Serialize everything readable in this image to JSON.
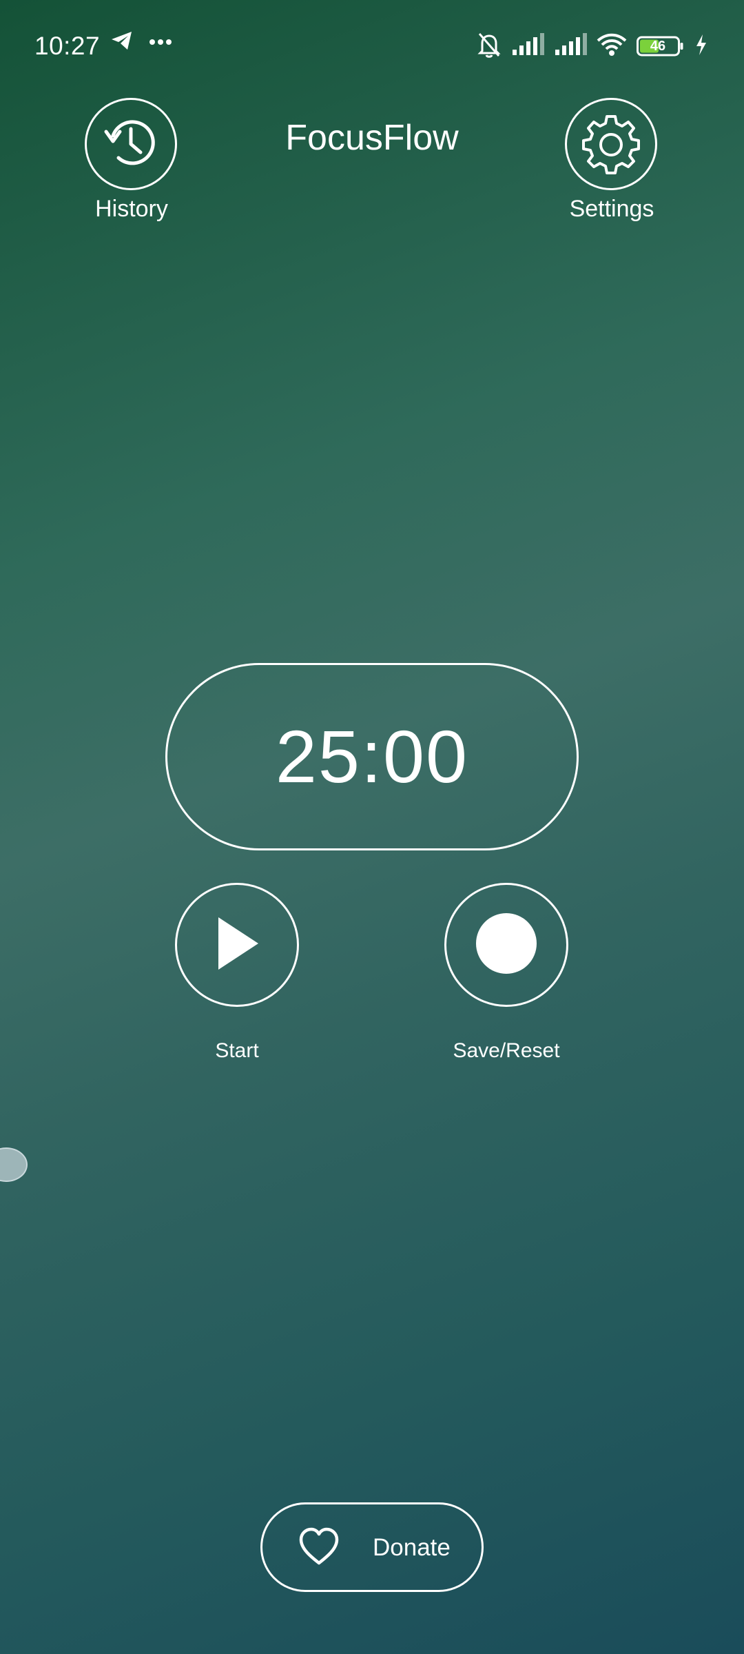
{
  "status_bar": {
    "time": "10:27",
    "battery_level": "46",
    "icons": [
      "telegram-icon",
      "more-dots-icon",
      "mute-bell-icon",
      "signal-icon",
      "signal-icon",
      "wifi-icon",
      "battery-icon",
      "charging-icon"
    ]
  },
  "header": {
    "title": "FocusFlow",
    "history_label": "History",
    "settings_label": "Settings",
    "history_icon": "history-clock-icon",
    "settings_icon": "gear-icon"
  },
  "timer": {
    "display": "25:00"
  },
  "controls": {
    "start_label": "Start",
    "reset_label": "Save/Reset",
    "start_icon": "play-icon",
    "reset_icon": "record-dot-icon"
  },
  "donate": {
    "label": "Donate",
    "icon": "heart-icon"
  },
  "colors": {
    "foreground": "#ffffff",
    "gradient_top": "#145237",
    "gradient_mid": "#3d6e66",
    "gradient_bottom": "#1a4c5a",
    "edge_handle": "#9db5b8"
  }
}
